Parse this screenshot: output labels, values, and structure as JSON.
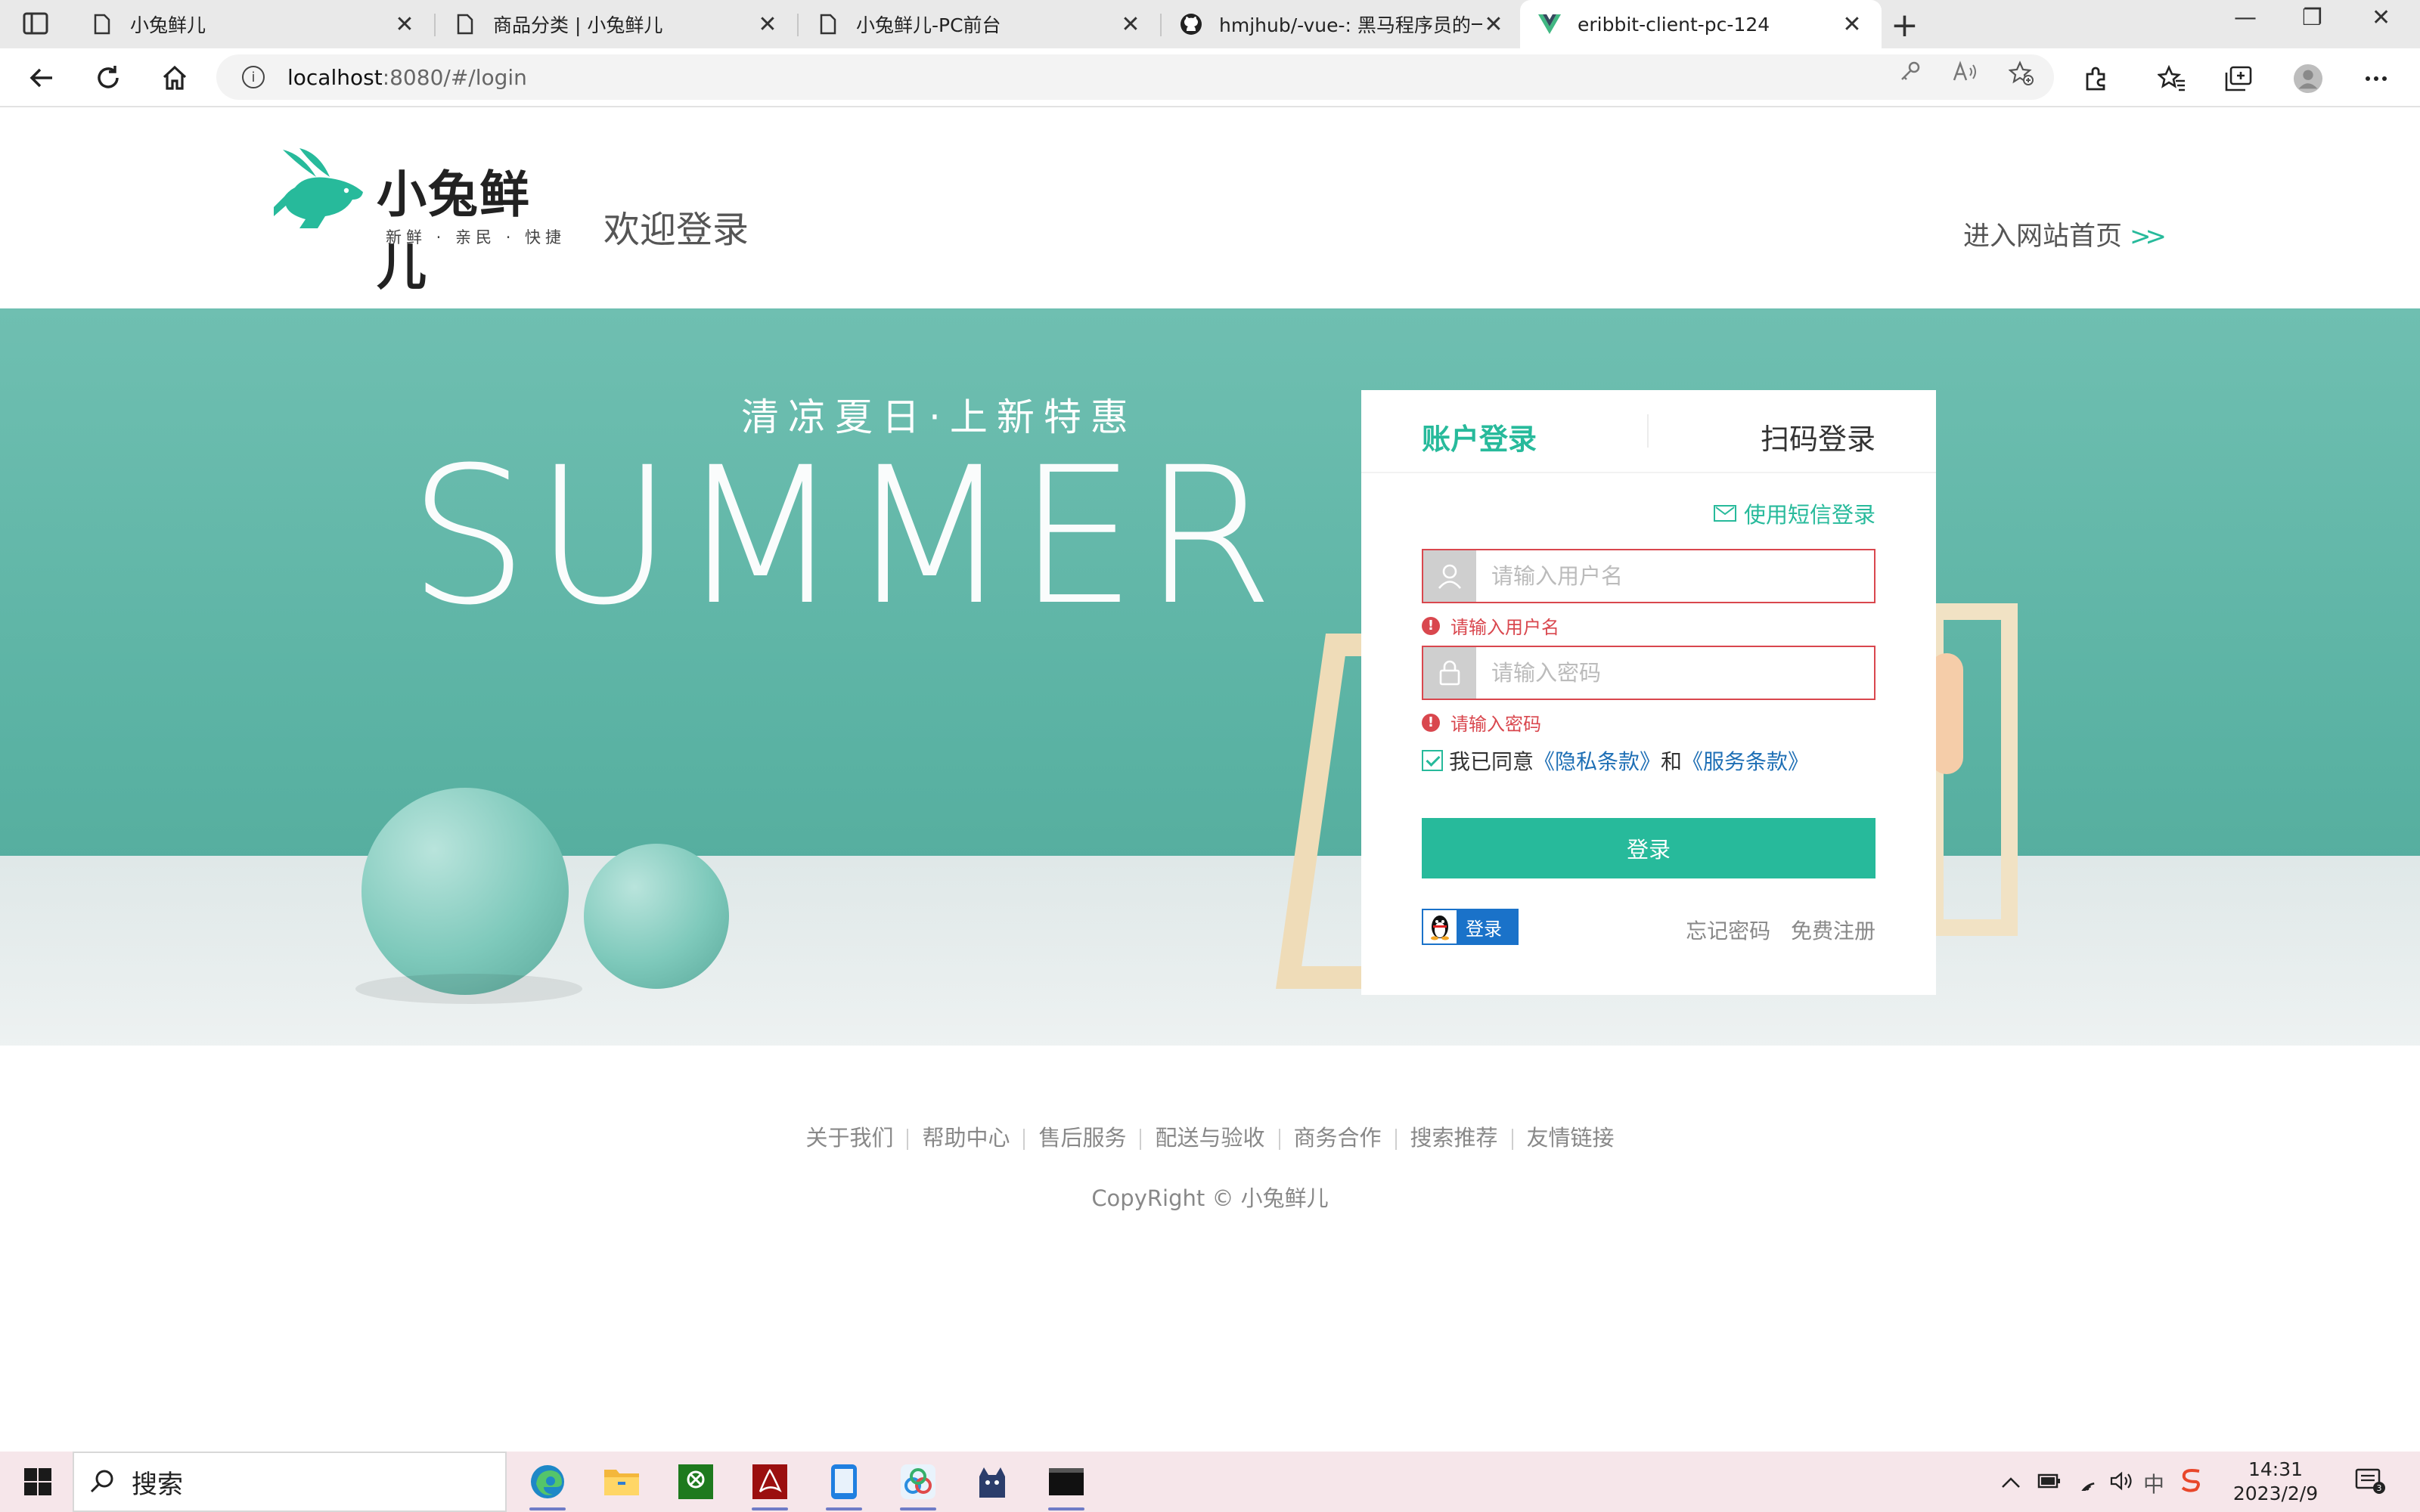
{
  "browser": {
    "tabs": [
      {
        "label": "小兔鲜儿",
        "active": false
      },
      {
        "label": "商品分类 | 小兔鲜儿",
        "active": false
      },
      {
        "label": "小兔鲜儿-PC前台",
        "active": false
      },
      {
        "label": "hmjhub/-vue-: 黑马程序员的一个",
        "active": false
      },
      {
        "label": "eribbit-client-pc-124",
        "active": true
      }
    ],
    "url_host": "localhost",
    "url_rest": ":8080/#/login"
  },
  "header": {
    "logo_text": "小兔鲜儿",
    "logo_subtitle": "新鲜 · 亲民 · 快捷",
    "welcome": "欢迎登录",
    "goto_home": "进入网站首页",
    "goto_arrows": ">>"
  },
  "banner": {
    "slogan_cn": "清凉夏日·上新特惠",
    "slogan_en": "SUMMER"
  },
  "login": {
    "tab_account": "账户登录",
    "tab_qr": "扫码登录",
    "sms_link": "使用短信登录",
    "username_placeholder": "请输入用户名",
    "username_error": "请输入用户名",
    "password_placeholder": "请输入密码",
    "password_error": "请输入密码",
    "agree_prefix": "我已同意",
    "privacy": "《隐私条款》",
    "agree_and": "和",
    "service": "《服务条款》",
    "submit": "登录",
    "qq_login": "登录",
    "forgot": "忘记密码",
    "register": "免费注册"
  },
  "footer": {
    "links": [
      "关于我们",
      "帮助中心",
      "售后服务",
      "配送与验收",
      "商务合作",
      "搜索推荐",
      "友情链接"
    ],
    "copyright": "CopyRight © 小兔鲜儿"
  },
  "taskbar": {
    "search_placeholder": "搜索",
    "time": "14:31",
    "date": "2023/2/9",
    "ime": "中"
  },
  "colors": {
    "accent": "#27ba9b",
    "error": "#d9474e",
    "link": "#1e6fb5",
    "banner": "#5ab2a3"
  }
}
